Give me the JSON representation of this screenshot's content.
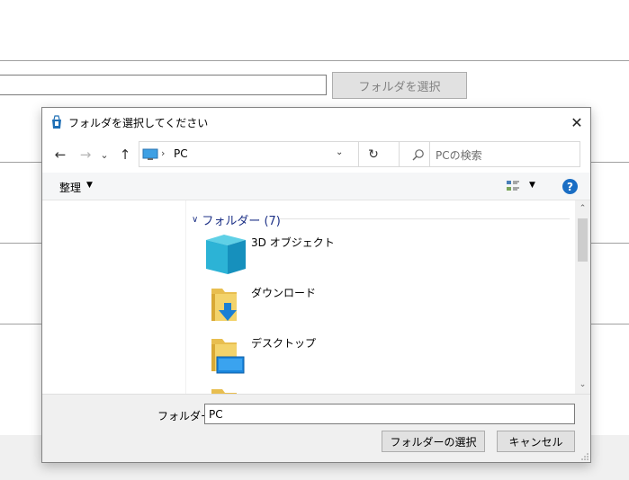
{
  "background": {
    "select_button_label": "フォルダを選択"
  },
  "dialog": {
    "title": "フォルダを選択してください",
    "close_glyph": "✕",
    "nav": {
      "back_glyph": "←",
      "forward_glyph": "→",
      "recent_glyph": "⌄",
      "up_glyph": "↑",
      "address_sep": "›",
      "address_location": "PC",
      "address_dropdown_glyph": "⌄",
      "refresh_glyph": "↻",
      "search_placeholder": "PCの検索"
    },
    "commandbar": {
      "organize_label": "整理",
      "dropdown_glyph": "▼",
      "help_glyph": "?"
    },
    "content": {
      "group_chevron": "∨",
      "group_header": "フォルダー (7)",
      "items": [
        {
          "label": "3D オブジェクト",
          "icon": "3d-objects-icon"
        },
        {
          "label": "ダウンロード",
          "icon": "downloads-folder-icon"
        },
        {
          "label": "デスクトップ",
          "icon": "desktop-folder-icon"
        }
      ]
    },
    "scrollbar": {
      "up_glyph": "⌃",
      "down_glyph": "⌄"
    },
    "footer": {
      "folder_label": "フォルダー:",
      "folder_value": "PC",
      "select_button_label": "フォルダーの選択",
      "cancel_button_label": "キャンセル"
    }
  },
  "colors": {
    "accent_blue": "#1a6ec4",
    "group_header": "#1e3287",
    "folder_yellow": "#f3d36b",
    "button_gray": "#e1e1e1"
  }
}
